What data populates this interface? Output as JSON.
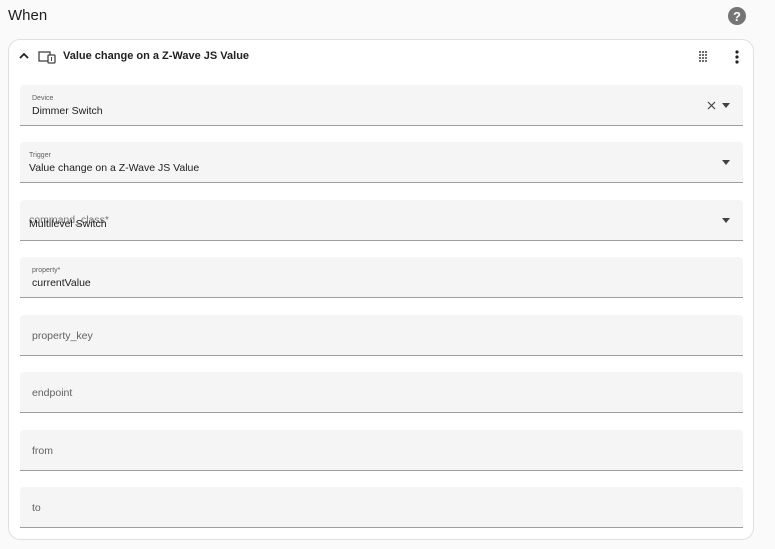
{
  "header": {
    "title": "When",
    "help_icon": "help-circle-icon",
    "help_glyph": "?"
  },
  "trigger_card": {
    "title": "Value change on a Z-Wave JS Value",
    "icons": {
      "collapse": "chevron-up-icon",
      "type": "devices-icon",
      "drag": "drag-handle-icon",
      "menu": "more-vertical-icon"
    },
    "fields": {
      "device": {
        "label": "Device",
        "value": "Dimmer Switch",
        "type": "select"
      },
      "trigger": {
        "label": "Trigger",
        "value": "Value change on a Z-Wave JS Value",
        "type": "select"
      },
      "command_class": {
        "label": "command_class*",
        "value": "Multilevel Switch",
        "type": "select"
      },
      "property": {
        "label": "property*",
        "value": "currentValue",
        "type": "text"
      },
      "property_key": {
        "placeholder": "property_key",
        "type": "text"
      },
      "endpoint": {
        "placeholder": "endpoint",
        "type": "text"
      },
      "from": {
        "placeholder": "from",
        "type": "text"
      },
      "to": {
        "placeholder": "to",
        "type": "text"
      }
    }
  },
  "colors": {
    "field_background": "#f5f5f5",
    "underline": "#9e9e9e",
    "icon": "#424242"
  }
}
